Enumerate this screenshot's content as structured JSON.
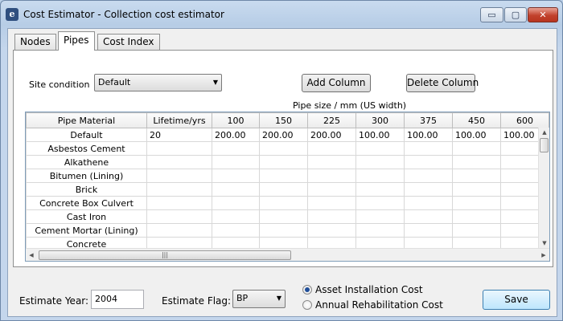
{
  "window": {
    "title": "Cost Estimator - Collection cost estimator",
    "app_icon": "e",
    "controls": {
      "minimize": "▭",
      "maximize": "▢",
      "close": "✕"
    }
  },
  "tabs": [
    {
      "label": "Nodes",
      "active": false
    },
    {
      "label": "Pipes",
      "active": true
    },
    {
      "label": "Cost Index",
      "active": false
    }
  ],
  "pipes": {
    "site_condition_label": "Site condition",
    "site_condition_value": "Default",
    "add_column_label": "Add Column",
    "delete_column_label": "Delete Column",
    "pipe_size_caption": "Pipe size / mm   (US width)",
    "grid": {
      "columns": [
        "Pipe Material",
        "Lifetime/yrs",
        "100",
        "150",
        "225",
        "300",
        "375",
        "450",
        "600"
      ],
      "rows": [
        [
          "Default",
          "20",
          "200.00",
          "200.00",
          "200.00",
          "100.00",
          "100.00",
          "100.00",
          "100.00"
        ],
        [
          "Asbestos Cement",
          "",
          "",
          "",
          "",
          "",
          "",
          "",
          ""
        ],
        [
          "Alkathene",
          "",
          "",
          "",
          "",
          "",
          "",
          "",
          ""
        ],
        [
          "Bitumen (Lining)",
          "",
          "",
          "",
          "",
          "",
          "",
          "",
          ""
        ],
        [
          "Brick",
          "",
          "",
          "",
          "",
          "",
          "",
          "",
          ""
        ],
        [
          "Concrete Box Culvert",
          "",
          "",
          "",
          "",
          "",
          "",
          "",
          ""
        ],
        [
          "Cast Iron",
          "",
          "",
          "",
          "",
          "",
          "",
          "",
          ""
        ],
        [
          "Cement Mortar (Lining)",
          "",
          "",
          "",
          "",
          "",
          "",
          "",
          ""
        ],
        [
          "Concrete",
          "",
          "",
          "",
          "",
          "",
          "",
          "",
          ""
        ]
      ]
    }
  },
  "footer": {
    "estimate_year_label": "Estimate Year:",
    "estimate_year_value": "2004",
    "estimate_flag_label": "Estimate Flag:",
    "estimate_flag_value": "BP",
    "radio_asset_label": "Asset Installation Cost",
    "radio_rehab_label": "Annual Rehabilitation Cost",
    "radio_selected": "asset",
    "save_label": "Save"
  }
}
